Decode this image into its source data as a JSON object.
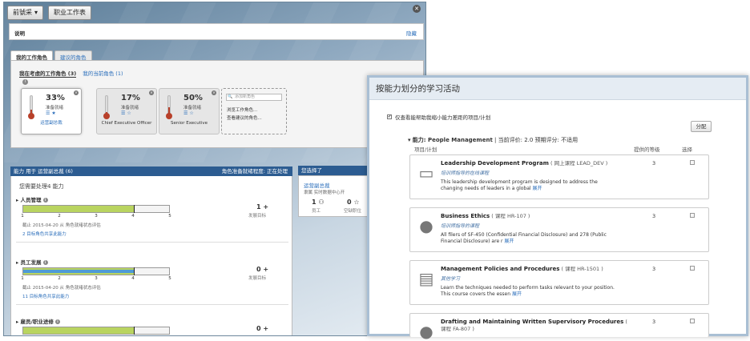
{
  "topbar": {
    "menu_label": "前號采",
    "menu_arrow": "▾",
    "button2_label": "职业工作表"
  },
  "desc": {
    "label": "说明",
    "hide": "隐藏"
  },
  "tabs": {
    "tab1": "我的工作角色",
    "tab2": "建议的角色"
  },
  "roles": {
    "subtab1": "我在考虑的工作角色 (3)",
    "subtab2": "我的当前角色 (1)",
    "cards": [
      {
        "pct": "33%",
        "ready": "准备就绪",
        "name": "运营副总裁",
        "value": 0.33
      },
      {
        "pct": "17%",
        "ready": "准备就绪",
        "name": "Chief Executive Officer",
        "value": 0.17
      },
      {
        "pct": "50%",
        "ready": "准备就绪",
        "name": "Senior Executive",
        "value": 0.5
      }
    ],
    "search_placeholder": "添加新角色",
    "browse": "浏览工作角色...",
    "view_suggested": "查看建议的角色..."
  },
  "capability": {
    "header": "能力 用于 运营副总裁 (6)",
    "header_right": "角色准备就绪程度:  正在处理",
    "need": "您需要处理4 能力",
    "items": [
      {
        "title": "人员管理",
        "green": 4,
        "blue": 1,
        "marker": 4,
        "date": "截止 2015-04-20 从 角色就绪状态评估",
        "link": "2 目标角色共享此能力",
        "count": "1 +",
        "glabel": "发展目标"
      },
      {
        "title": "员工发展",
        "green": 4,
        "blue": 4,
        "marker": 4,
        "date": "截止 2015-04-20 从 角色就绪状态评估",
        "link": "11 目标角色共享此能力",
        "count": "0 +",
        "glabel": "发展目标"
      },
      {
        "title": "雇员/职业进修",
        "green": 4,
        "blue": 1,
        "marker": 4,
        "date": "",
        "link": "",
        "count": "0 +",
        "glabel": ""
      }
    ],
    "ticks": [
      "1",
      "2",
      "3",
      "4",
      "5"
    ]
  },
  "selected": {
    "header": "您选择了",
    "title": "运营副总裁",
    "sub": "隶属 实时数据中心开",
    "n1": "1 ⚇",
    "n2": "0 ☆",
    "l1": "员工",
    "l2": "空缺职位"
  },
  "learning": {
    "title": "按能力划分的学习活动",
    "checkbox_label": "仅查看能帮助我缩小能力差距的项目/计划",
    "checkbox_mark": "✔",
    "distribute": "分配",
    "cap_name": "能力: People Management",
    "cap_rest": " | 当前评价: 2.0  预期评分: 不适用",
    "col_item": "项目/计划",
    "col_level": "提供的等级",
    "col_select": "选择",
    "items": [
      {
        "title": "Leadership Development Program",
        "meta": " ( 网上课程 LEAD_DEV )",
        "sub": "培训师指导的在线课程",
        "desc": "This leadership development program is designed to address the changing needs of leaders in a global ",
        "more": "展开",
        "level": "3",
        "icon": "▭"
      },
      {
        "title": "Business Ethics",
        "meta": " ( 课程 HR-107 )",
        "sub": "培训师指导的课程",
        "desc": "All filers of SF-450 (Confidential Financial Disclosure) and 278 (Public Financial Disclosure) are r ",
        "more": "展开",
        "level": "3",
        "icon": "●"
      },
      {
        "title": "Management Policies and Procedures",
        "meta": " ( 课程 HR-1501 )",
        "sub": "其他学习",
        "desc": "Learn the techniques needed to perform tasks relevant to your position. This course covers the essen ",
        "more": "展开",
        "level": "3",
        "icon": "▤"
      },
      {
        "title": "Drafting and Maintaining Written Supervisory Procedures",
        "meta": " ( 课程 FA-807 )",
        "sub": "",
        "desc": "",
        "more": "",
        "level": "3",
        "icon": "●"
      }
    ]
  }
}
